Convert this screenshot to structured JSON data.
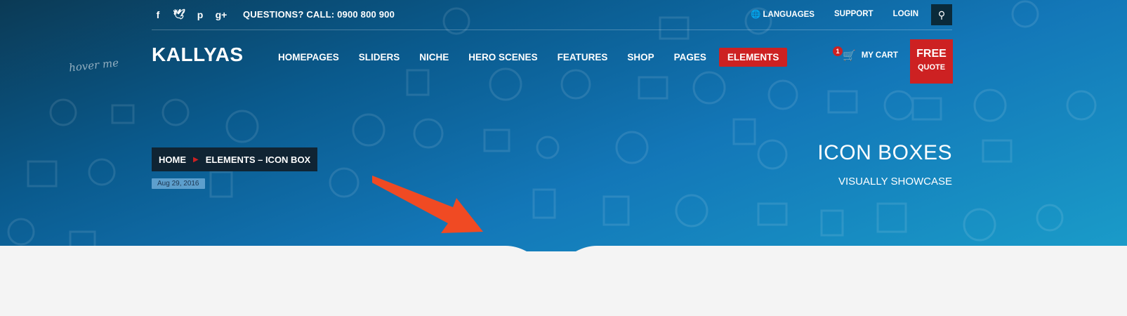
{
  "topbar": {
    "social": [
      {
        "icon": "facebook-icon",
        "glyph": "f"
      },
      {
        "icon": "twitter-icon",
        "glyph": "🐦"
      },
      {
        "icon": "pinterest-icon",
        "glyph": "p"
      },
      {
        "icon": "google-plus-icon",
        "glyph": "g+"
      }
    ],
    "phone": "QUESTIONS? CALL: 0900 800 900",
    "languages": "LANGUAGES",
    "support": "SUPPORT",
    "login": "LOGIN"
  },
  "header": {
    "logo": "KALLYAS",
    "hover_hint": "hover me",
    "nav": [
      "HOMEPAGES",
      "SLIDERS",
      "NICHE",
      "HERO SCENES",
      "FEATURES",
      "SHOP",
      "PAGES",
      "ELEMENTS"
    ],
    "active_nav": "ELEMENTS",
    "cart_count": "1",
    "cart_label": "MY CART",
    "free": "FREE",
    "quote": "QUOTE"
  },
  "breadcrumb": {
    "home": "HOME",
    "current": "ELEMENTS – ICON BOX"
  },
  "date": "Aug 29, 2016",
  "hero": {
    "title": "ICON BOXES",
    "subtitle": "VISUALLY SHOWCASE"
  },
  "colors": {
    "accent": "#cd2122",
    "hero_dark": "#0b3a55",
    "hero_light": "#1a9cc9",
    "breadcrumb_bg": "#102433",
    "body_bg": "#f4f4f4",
    "arrow": "#f04a23"
  }
}
